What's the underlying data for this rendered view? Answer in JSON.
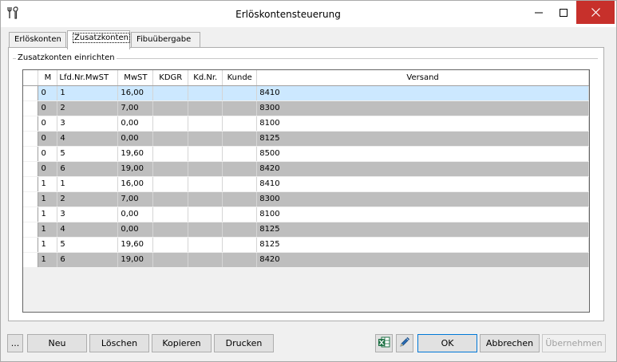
{
  "window": {
    "title": "Erlöskontensteuerung"
  },
  "tabs": [
    {
      "label": "Erlöskonten",
      "active": false
    },
    {
      "label": "Zusatzkonten",
      "active": true
    },
    {
      "label": "Fibuübergabe",
      "active": false
    }
  ],
  "groupbox": {
    "title": "Zusatzkonten einrichten"
  },
  "grid": {
    "columns": [
      "M",
      "Lfd.Nr.MwST",
      "MwST",
      "KDGR",
      "Kd.Nr.",
      "Kunde",
      "Versand"
    ],
    "rows": [
      [
        "0",
        "1",
        "16,00",
        "",
        "",
        "",
        "8410"
      ],
      [
        "0",
        "2",
        "7,00",
        "",
        "",
        "",
        "8300"
      ],
      [
        "0",
        "3",
        "0,00",
        "",
        "",
        "",
        "8100"
      ],
      [
        "0",
        "4",
        "0,00",
        "",
        "",
        "",
        "8125"
      ],
      [
        "0",
        "5",
        "19,60",
        "",
        "",
        "",
        "8500"
      ],
      [
        "0",
        "6",
        "19,00",
        "",
        "",
        "",
        "8420"
      ],
      [
        "1",
        "1",
        "16,00",
        "",
        "",
        "",
        "8410"
      ],
      [
        "1",
        "2",
        "7,00",
        "",
        "",
        "",
        "8300"
      ],
      [
        "1",
        "3",
        "0,00",
        "",
        "",
        "",
        "8100"
      ],
      [
        "1",
        "4",
        "0,00",
        "",
        "",
        "",
        "8125"
      ],
      [
        "1",
        "5",
        "19,60",
        "",
        "",
        "",
        "8125"
      ],
      [
        "1",
        "6",
        "19,00",
        "",
        "",
        "",
        "8420"
      ]
    ]
  },
  "buttons": {
    "more": "...",
    "new": "Neu",
    "delete": "Löschen",
    "copy": "Kopieren",
    "print": "Drucken",
    "ok": "OK",
    "cancel": "Abbrechen",
    "apply": "Übernehmen"
  },
  "icons": {
    "app": "tools-icon",
    "excel": "excel-icon",
    "edit": "pencil-icon"
  },
  "colors": {
    "selected_row": "#cce8ff",
    "alt_row": "#bebebe",
    "close_button": "#c7302b",
    "ok_border": "#0078d7"
  }
}
